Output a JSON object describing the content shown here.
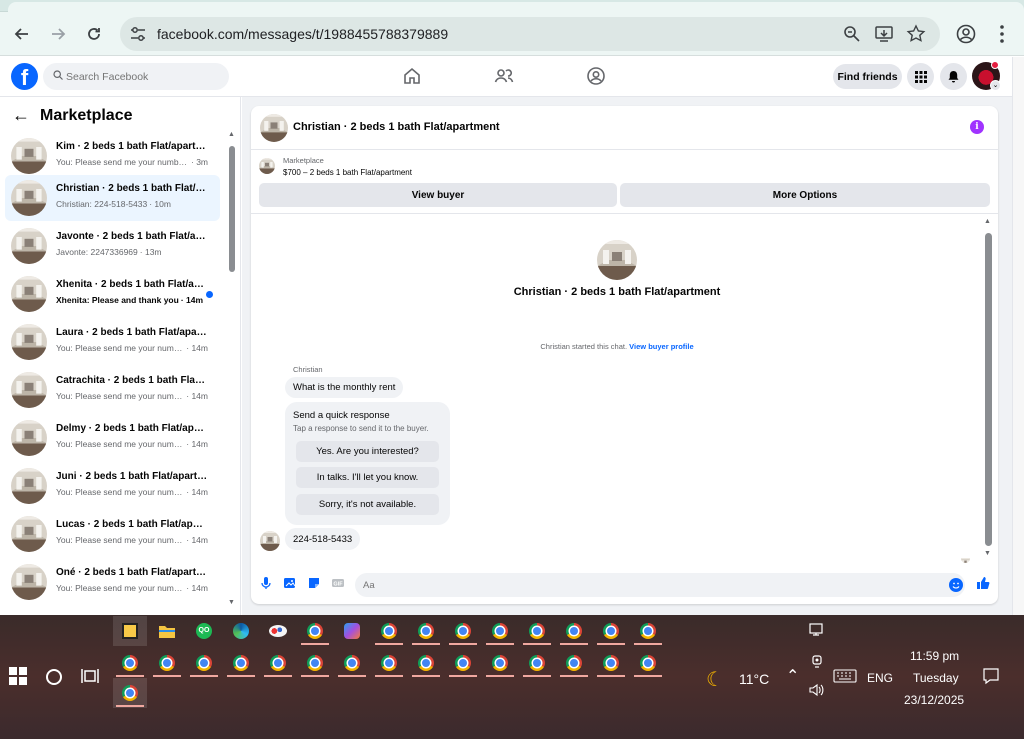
{
  "browser": {
    "url": "facebook.com/messages/t/1988455788379889",
    "back_icon": "arrow-left-icon",
    "forward_icon": "arrow-right-icon",
    "reload_icon": "reload-icon"
  },
  "header": {
    "search_placeholder": "Search Facebook",
    "find_friends": "Find friends"
  },
  "sidebar": {
    "title": "Marketplace",
    "conversations": [
      {
        "name": "Kim · 2 beds 1 bath Flat/apartment",
        "message": "You: Please send me your numbe...",
        "time": "· 3m"
      },
      {
        "name": "Christian · 2 beds 1 bath Flat/apartment",
        "message": "Christian: 224-518-5433",
        "time": "· 10m"
      },
      {
        "name": "Javonte · 2 beds 1 bath Flat/apartment",
        "message": "Javonte: 2247336969",
        "time": "· 13m"
      },
      {
        "name": "Xhenita · 2 beds 1 bath Flat/apartment",
        "message": "Xhenita: Please and thank you",
        "time": "· 14m"
      },
      {
        "name": "Laura · 2 beds 1 bath Flat/apartment",
        "message": "You: Please send me your numb...",
        "time": "· 14m"
      },
      {
        "name": "Catrachita · 2 beds 1 bath Flat/apartment",
        "message": "You: Please send me your numb...",
        "time": "· 14m"
      },
      {
        "name": "Delmy · 2 beds 1 bath Flat/apartment",
        "message": "You: Please send me your numb...",
        "time": "· 14m"
      },
      {
        "name": "Juni · 2 beds 1 bath Flat/apartment",
        "message": "You: Please send me your numb...",
        "time": "· 14m"
      },
      {
        "name": "Lucas · 2 beds 1 bath Flat/apartment",
        "message": "You: Please send me your numb...",
        "time": "· 14m"
      },
      {
        "name": "Oné · 2 beds 1 bath Flat/apartment",
        "message": "You: Please send me your numb...",
        "time": "· 14m"
      }
    ]
  },
  "chat": {
    "title": "Christian · 2 beds 1 bath Flat/apartment",
    "marketplace_label": "Marketplace",
    "listing_price": "$700 – 2 beds 1 bath Flat/apartment",
    "view_buyer": "View buyer",
    "more_options": "More Options",
    "center_name": "Christian · 2 beds 1 bath Flat/apartment",
    "started_text": "Christian started this chat.",
    "view_buyer_profile": "View buyer profile",
    "sender": "Christian",
    "first_message": "What is the monthly rent",
    "quick_title": "Send a quick response",
    "quick_subtitle": "Tap a response to send it to the buyer.",
    "quick_responses": [
      "Yes. Are you interested?",
      "In talks. I'll let you know.",
      "Sorry, it's not available."
    ],
    "last_message": "224-518-5433",
    "composer_placeholder": "Aa"
  },
  "taskbar": {
    "weather": "11°C",
    "language": "ENG",
    "time": "11:59 pm",
    "day": "Tuesday",
    "date": "23/12/2025"
  },
  "colors": {
    "fb_blue": "#0866ff",
    "active_row": "#ebf5ff",
    "info_purple": "#a033ff",
    "browser_bg": "#edf6f4"
  }
}
